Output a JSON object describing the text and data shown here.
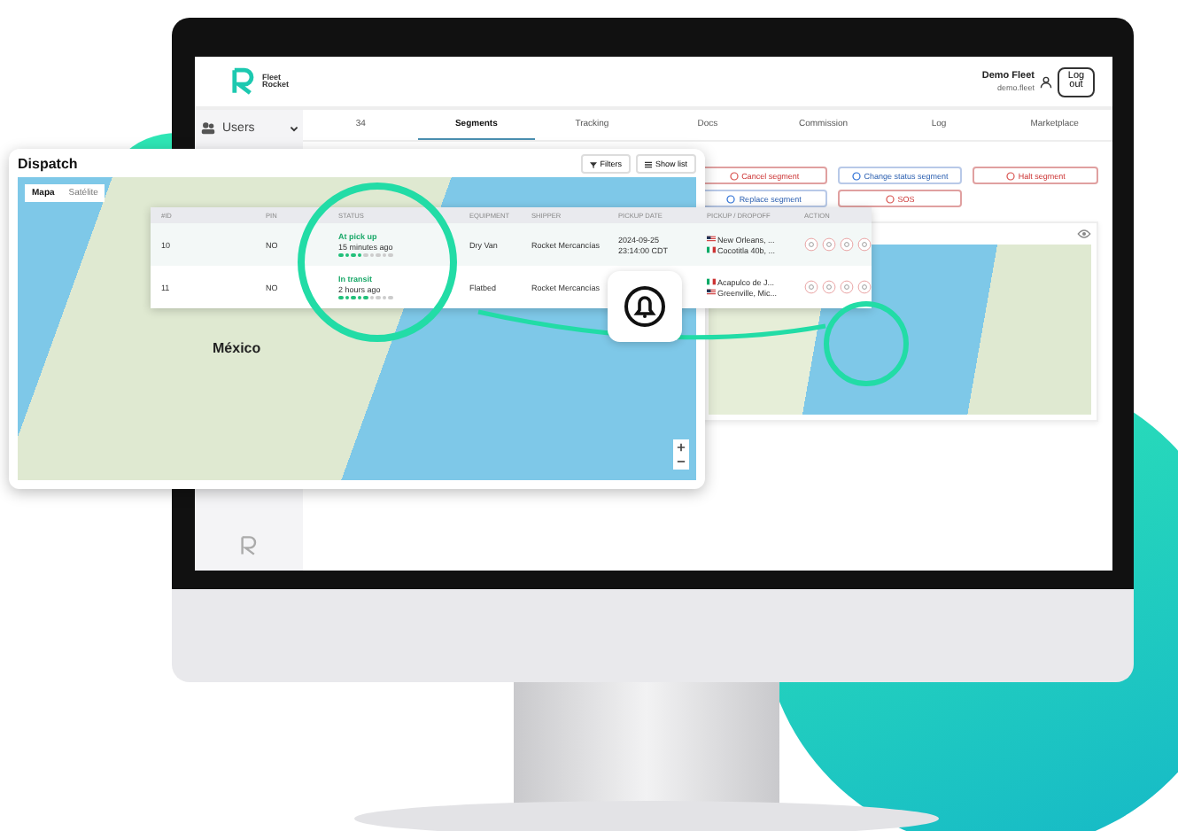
{
  "header": {
    "brand_top": "Fleet",
    "brand_bottom": "Rocket",
    "user_name": "Demo Fleet",
    "user_handle": "demo.fleet",
    "logout": "Log out"
  },
  "sidebar": {
    "items": [
      {
        "label": "Users",
        "expanded": false
      }
    ]
  },
  "tabs": [
    {
      "label": "34",
      "selected": false
    },
    {
      "label": "Segments",
      "selected": true
    },
    {
      "label": "Tracking",
      "selected": false
    },
    {
      "label": "Docs",
      "selected": false
    },
    {
      "label": "Commission",
      "selected": false
    },
    {
      "label": "Log",
      "selected": false
    },
    {
      "label": "Marketplace",
      "selected": false
    }
  ],
  "actions": [
    {
      "label": "Cancel segment",
      "kind": "danger"
    },
    {
      "label": "Change status segment",
      "kind": "info"
    },
    {
      "label": "Halt segment",
      "kind": "danger"
    },
    {
      "label": "Replace segment",
      "kind": "info"
    },
    {
      "label": "SOS",
      "kind": "danger"
    }
  ],
  "dispatch": {
    "title": "Dispatch",
    "map_types": [
      {
        "label": "Mapa",
        "selected": true
      },
      {
        "label": "Satélite",
        "selected": false
      }
    ],
    "filters": "Filters",
    "show_list": "Show list",
    "map_label": "México"
  },
  "table": {
    "columns": [
      "#ID",
      "PIN",
      "STATUS",
      "EQUIPMENT",
      "SHIPPER",
      "PICKUP DATE",
      "PICKUP / DROPOFF",
      "ACTION"
    ],
    "rows": [
      {
        "id": "10",
        "pin": "NO",
        "status": "At pick up",
        "status_time": "15 minutes ago",
        "stars": 4,
        "equipment": "Dry Van",
        "shipper": "Rocket Mercancías",
        "pickup_date": "2024-09-25",
        "pickup_time": "23:14:00 CDT",
        "stops": [
          {
            "kind": "us",
            "place": "New Orleans, ..."
          },
          {
            "kind": "mx",
            "place": "Cocotitla 40b, ..."
          }
        ]
      },
      {
        "id": "11",
        "pin": "NO",
        "status": "In transit",
        "status_time": "2 hours ago",
        "stars": 5,
        "equipment": "Flatbed",
        "shipper": "Rocket Mercancías",
        "stops": [
          {
            "kind": "mx",
            "place": "Acapulco de J..."
          },
          {
            "kind": "us",
            "place": "Greenville, Mic..."
          }
        ]
      }
    ]
  }
}
